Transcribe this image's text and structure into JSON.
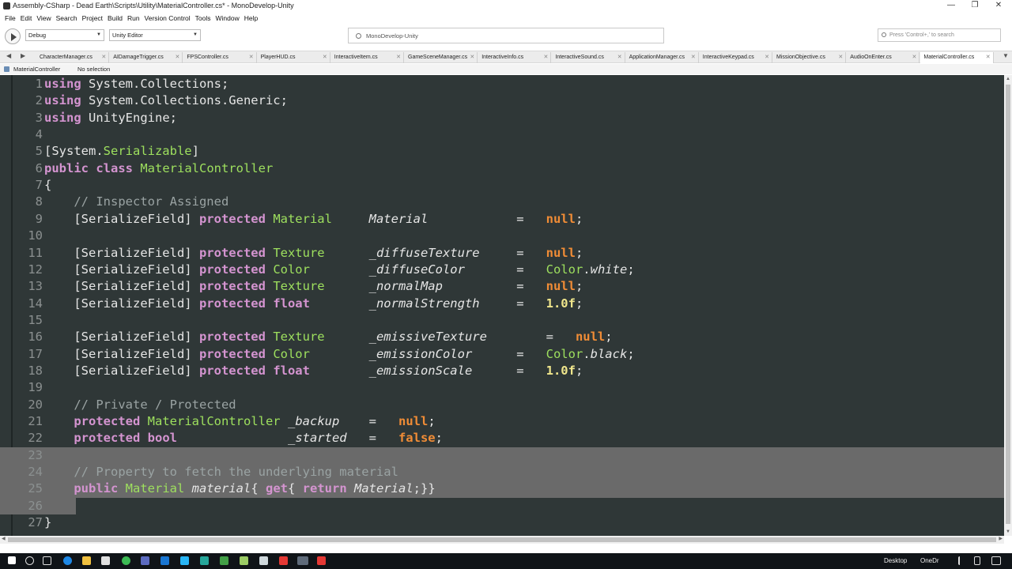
{
  "window": {
    "title": "Assembly-CSharp - Dead Earth\\Scripts\\Utility\\MaterialController.cs* - MonoDevelop-Unity",
    "minimize": "—",
    "maximize": "❐",
    "close": "✕"
  },
  "menu": [
    "File",
    "Edit",
    "View",
    "Search",
    "Project",
    "Build",
    "Run",
    "Version Control",
    "Tools",
    "Window",
    "Help"
  ],
  "toolbar": {
    "config": "Debug",
    "target": "Unity Editor",
    "status": "MonoDevelop-Unity",
    "search_placeholder": "Press 'Control+,' to search"
  },
  "tabs": [
    {
      "label": "CharacterManager.cs",
      "active": false
    },
    {
      "label": "AIDamageTrigger.cs",
      "active": false
    },
    {
      "label": "FPSController.cs",
      "active": false
    },
    {
      "label": "PlayerHUD.cs",
      "active": false
    },
    {
      "label": "InteractiveItem.cs",
      "active": false
    },
    {
      "label": "GameSceneManager.cs",
      "active": false
    },
    {
      "label": "InteractiveInfo.cs",
      "active": false
    },
    {
      "label": "InteractiveSound.cs",
      "active": false
    },
    {
      "label": "ApplicationManager.cs",
      "active": false
    },
    {
      "label": "InteractiveKeypad.cs",
      "active": false
    },
    {
      "label": "MissionObjective.cs",
      "active": false
    },
    {
      "label": "AudioOnEnter.cs",
      "active": false
    },
    {
      "label": "MaterialController.cs",
      "active": true
    }
  ],
  "breadcrumb": {
    "class": "MaterialController",
    "member": "No selection"
  },
  "colors": {
    "editor_bg": "#2f3737",
    "keyword": "#d494d0",
    "type": "#9ee05e",
    "comment": "#9aa3a3",
    "literal": "#f08c36",
    "number": "#f0e68c",
    "plain": "#e6e6e6"
  },
  "code_lines": [
    {
      "n": "1",
      "sel": "",
      "tokens": [
        [
          "kw",
          "using"
        ],
        [
          "p",
          " System.Collections;"
        ]
      ]
    },
    {
      "n": "2",
      "sel": "",
      "tokens": [
        [
          "kw",
          "using"
        ],
        [
          "p",
          " System.Collections.Generic;"
        ]
      ]
    },
    {
      "n": "3",
      "sel": "",
      "tokens": [
        [
          "kw",
          "using"
        ],
        [
          "p",
          " UnityEngine;"
        ]
      ]
    },
    {
      "n": "4",
      "sel": "",
      "tokens": []
    },
    {
      "n": "5",
      "sel": "",
      "tokens": [
        [
          "p",
          "[System."
        ],
        [
          "ty",
          "Serializable"
        ],
        [
          "p",
          "]"
        ]
      ]
    },
    {
      "n": "6",
      "sel": "",
      "tokens": [
        [
          "kw",
          "public class"
        ],
        [
          "p",
          " "
        ],
        [
          "ty",
          "MaterialController"
        ]
      ]
    },
    {
      "n": "7",
      "sel": "",
      "tokens": [
        [
          "p",
          "{"
        ]
      ]
    },
    {
      "n": "8",
      "sel": "",
      "tokens": [
        [
          "p",
          "    "
        ],
        [
          "cm",
          "// Inspector Assigned"
        ]
      ]
    },
    {
      "n": "9",
      "sel": "",
      "tokens": [
        [
          "p",
          "    [SerializeField] "
        ],
        [
          "kw",
          "protected"
        ],
        [
          "p",
          " "
        ],
        [
          "ty",
          "Material"
        ],
        [
          "p",
          "     "
        ],
        [
          "it",
          "Material"
        ],
        [
          "p",
          "            =   "
        ],
        [
          "lit",
          "null"
        ],
        [
          "p",
          ";"
        ]
      ]
    },
    {
      "n": "10",
      "sel": "",
      "tokens": []
    },
    {
      "n": "11",
      "sel": "",
      "tokens": [
        [
          "p",
          "    [SerializeField] "
        ],
        [
          "kw",
          "protected"
        ],
        [
          "p",
          " "
        ],
        [
          "ty",
          "Texture"
        ],
        [
          "p",
          "      "
        ],
        [
          "it",
          "_diffuseTexture"
        ],
        [
          "p",
          "     =   "
        ],
        [
          "lit",
          "null"
        ],
        [
          "p",
          ";"
        ]
      ]
    },
    {
      "n": "12",
      "sel": "",
      "tokens": [
        [
          "p",
          "    [SerializeField] "
        ],
        [
          "kw",
          "protected"
        ],
        [
          "p",
          " "
        ],
        [
          "ty",
          "Color"
        ],
        [
          "p",
          "        "
        ],
        [
          "it",
          "_diffuseColor"
        ],
        [
          "p",
          "       =   "
        ],
        [
          "ty",
          "Color"
        ],
        [
          "p",
          "."
        ],
        [
          "it",
          "white"
        ],
        [
          "p",
          ";"
        ]
      ]
    },
    {
      "n": "13",
      "sel": "",
      "tokens": [
        [
          "p",
          "    [SerializeField] "
        ],
        [
          "kw",
          "protected"
        ],
        [
          "p",
          " "
        ],
        [
          "ty",
          "Texture"
        ],
        [
          "p",
          "      "
        ],
        [
          "it",
          "_normalMap"
        ],
        [
          "p",
          "          =   "
        ],
        [
          "lit",
          "null"
        ],
        [
          "p",
          ";"
        ]
      ]
    },
    {
      "n": "14",
      "sel": "",
      "tokens": [
        [
          "p",
          "    [SerializeField] "
        ],
        [
          "kw",
          "protected"
        ],
        [
          "p",
          " "
        ],
        [
          "kw",
          "float"
        ],
        [
          "p",
          "        "
        ],
        [
          "it",
          "_normalStrength"
        ],
        [
          "p",
          "     =   "
        ],
        [
          "num",
          "1.0f"
        ],
        [
          "p",
          ";"
        ]
      ]
    },
    {
      "n": "15",
      "sel": "",
      "tokens": []
    },
    {
      "n": "16",
      "sel": "",
      "tokens": [
        [
          "p",
          "    [SerializeField] "
        ],
        [
          "kw",
          "protected"
        ],
        [
          "p",
          " "
        ],
        [
          "ty",
          "Texture"
        ],
        [
          "p",
          "      "
        ],
        [
          "it",
          "_emissiveTexture"
        ],
        [
          "p",
          "        =   "
        ],
        [
          "lit",
          "null"
        ],
        [
          "p",
          ";"
        ]
      ]
    },
    {
      "n": "17",
      "sel": "",
      "tokens": [
        [
          "p",
          "    [SerializeField] "
        ],
        [
          "kw",
          "protected"
        ],
        [
          "p",
          " "
        ],
        [
          "ty",
          "Color"
        ],
        [
          "p",
          "        "
        ],
        [
          "it",
          "_emissionColor"
        ],
        [
          "p",
          "      =   "
        ],
        [
          "ty",
          "Color"
        ],
        [
          "p",
          "."
        ],
        [
          "it",
          "black"
        ],
        [
          "p",
          ";"
        ]
      ]
    },
    {
      "n": "18",
      "sel": "",
      "tokens": [
        [
          "p",
          "    [SerializeField] "
        ],
        [
          "kw",
          "protected"
        ],
        [
          "p",
          " "
        ],
        [
          "kw",
          "float"
        ],
        [
          "p",
          "        "
        ],
        [
          "it",
          "_emissionScale"
        ],
        [
          "p",
          "      =   "
        ],
        [
          "num",
          "1.0f"
        ],
        [
          "p",
          ";"
        ]
      ]
    },
    {
      "n": "19",
      "sel": "",
      "tokens": []
    },
    {
      "n": "20",
      "sel": "",
      "tokens": [
        [
          "p",
          "    "
        ],
        [
          "cm",
          "// Private / Protected"
        ]
      ]
    },
    {
      "n": "21",
      "sel": "",
      "tokens": [
        [
          "p",
          "    "
        ],
        [
          "kw",
          "protected"
        ],
        [
          "p",
          " "
        ],
        [
          "ty",
          "MaterialController"
        ],
        [
          "p",
          " "
        ],
        [
          "it",
          "_backup"
        ],
        [
          "p",
          "    =   "
        ],
        [
          "lit",
          "null"
        ],
        [
          "p",
          ";"
        ]
      ]
    },
    {
      "n": "22",
      "sel": "",
      "tokens": [
        [
          "p",
          "    "
        ],
        [
          "kw",
          "protected"
        ],
        [
          "p",
          " "
        ],
        [
          "kw",
          "bool"
        ],
        [
          "p",
          "               "
        ],
        [
          "it",
          "_started"
        ],
        [
          "p",
          "   =   "
        ],
        [
          "lit",
          "false"
        ],
        [
          "p",
          ";"
        ]
      ]
    },
    {
      "n": "23",
      "sel": "full",
      "tokens": []
    },
    {
      "n": "24",
      "sel": "full",
      "tokens": [
        [
          "p",
          "    "
        ],
        [
          "cm",
          "// Property to fetch the underlying material"
        ]
      ]
    },
    {
      "n": "25",
      "sel": "full",
      "tokens": [
        [
          "p",
          "    "
        ],
        [
          "kw",
          "public"
        ],
        [
          "p",
          " "
        ],
        [
          "ty",
          "Material"
        ],
        [
          "p",
          " "
        ],
        [
          "it",
          "material"
        ],
        [
          "p",
          "{ "
        ],
        [
          "kw",
          "get"
        ],
        [
          "p",
          "{ "
        ],
        [
          "kw",
          "return"
        ],
        [
          "p",
          " "
        ],
        [
          "it",
          "Material"
        ],
        [
          "p",
          ";}}"
        ]
      ]
    },
    {
      "n": "26",
      "sel": "partial",
      "tokens": []
    },
    {
      "n": "27",
      "sel": "",
      "tokens": [
        [
          "p",
          "}"
        ]
      ]
    }
  ],
  "taskbar": {
    "desktop_label": "Desktop",
    "onedrive_label": "OneDr"
  }
}
